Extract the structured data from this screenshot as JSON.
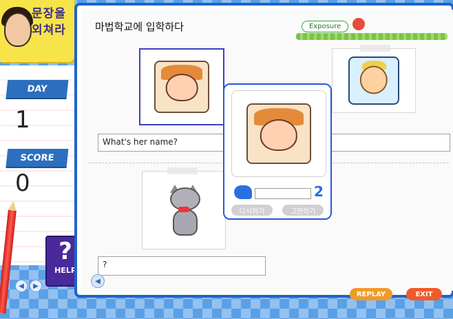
{
  "logo": {
    "text_line1": "문장을",
    "text_line2": "외쳐라"
  },
  "sidebar": {
    "day_label": "DAY",
    "day_value": "1",
    "score_label": "SCORE",
    "score_value": "0",
    "help_symbol": "?",
    "help_label": "HELP"
  },
  "page": {
    "title": "마법학교에 입학하다",
    "exposure_label": "Exposure"
  },
  "questions": [
    {
      "text": "What's her name?"
    },
    {
      "text": "?"
    }
  ],
  "popup": {
    "counter": "2",
    "retry_label": "다시하기",
    "stop_label": "그만하기"
  },
  "controls": {
    "replay_label": "REPLAY",
    "exit_label": "EXIT"
  },
  "colors": {
    "frame_blue": "#1d63c9",
    "accent_orange": "#f09a2a"
  }
}
